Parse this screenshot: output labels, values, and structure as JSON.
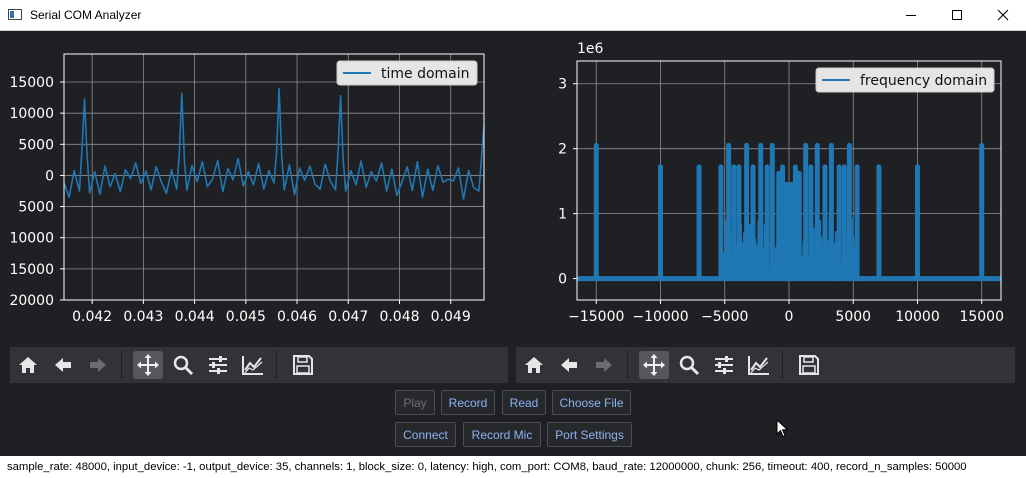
{
  "window": {
    "title": "Serial COM Analyzer",
    "controls": [
      "minimize-icon",
      "maximize-icon",
      "close-icon"
    ]
  },
  "plots": [
    {
      "chart_data": {
        "type": "line",
        "legend": "time domain",
        "legend_position": "top-right",
        "grid": true,
        "xlim": [
          0.04145,
          0.04965
        ],
        "ylim": [
          -20000,
          19500
        ],
        "x_ticks": [
          0.042,
          0.043,
          0.044,
          0.045,
          0.046,
          0.047,
          0.048,
          0.049
        ],
        "x_tick_labels": [
          "0.042",
          "0.043",
          "0.044",
          "0.045",
          "0.046",
          "0.047",
          "0.048",
          "0.049"
        ],
        "y_ticks": [
          15000,
          10000,
          5000,
          0,
          -5000,
          -10000,
          -15000,
          -20000
        ],
        "y_tick_labels": [
          "15000",
          "10000",
          "5000",
          "0",
          "5000",
          "10000",
          "15000",
          "20000"
        ],
        "series_color": "#1f77b4",
        "series": [
          {
            "name": "time domain",
            "x": [
              0.04145,
              0.04155,
              0.04165,
              0.04175,
              0.0418,
              0.04185,
              0.0419,
              0.04195,
              0.04205,
              0.04215,
              0.04225,
              0.04235,
              0.04245,
              0.04255,
              0.04265,
              0.04275,
              0.04285,
              0.04295,
              0.04305,
              0.04315,
              0.04325,
              0.04335,
              0.04345,
              0.04355,
              0.04365,
              0.0437,
              0.04375,
              0.0438,
              0.04385,
              0.04395,
              0.04405,
              0.04415,
              0.04425,
              0.04435,
              0.04445,
              0.04455,
              0.04465,
              0.04475,
              0.04485,
              0.04495,
              0.04505,
              0.04515,
              0.04525,
              0.04535,
              0.04545,
              0.04555,
              0.0456,
              0.04565,
              0.0457,
              0.04575,
              0.04585,
              0.04595,
              0.04605,
              0.04615,
              0.04625,
              0.04635,
              0.04645,
              0.04655,
              0.04665,
              0.04675,
              0.0468,
              0.04685,
              0.0469,
              0.04695,
              0.04705,
              0.04715,
              0.04725,
              0.04735,
              0.04745,
              0.04755,
              0.04765,
              0.04775,
              0.04785,
              0.04795,
              0.04805,
              0.04815,
              0.04825,
              0.04835,
              0.04845,
              0.04855,
              0.04865,
              0.04875,
              0.04885,
              0.04895,
              0.04905,
              0.04915,
              0.04925,
              0.04935,
              0.04945,
              0.04955,
              0.04965
            ],
            "values": [
              -1200,
              -3500,
              800,
              -2500,
              4000,
              12300,
              3500,
              -2800,
              600,
              -3000,
              1500,
              -1800,
              300,
              -2600,
              900,
              -500,
              2000,
              -1300,
              700,
              -2300,
              1400,
              -1000,
              -2900,
              900,
              -2200,
              3200,
              13200,
              2500,
              -2400,
              1600,
              -1000,
              2200,
              -1800,
              -600,
              2400,
              -2600,
              1100,
              -700,
              2700,
              -1700,
              600,
              -1500,
              1900,
              -2200,
              800,
              -1200,
              3800,
              14000,
              3100,
              -2300,
              1700,
              -3100,
              1200,
              -800,
              1500,
              -1400,
              -2200,
              1800,
              -900,
              -2300,
              3500,
              12800,
              2700,
              -2500,
              800,
              -1500,
              2300,
              -1900,
              600,
              -900,
              2000,
              -2500,
              1000,
              -3200,
              -1000,
              1400,
              -2400,
              2200,
              -3500,
              1000,
              -2400,
              1600,
              -1100,
              -600,
              -900,
              1200,
              -3800,
              800,
              -2000,
              -2500,
              8000
            ]
          }
        ]
      }
    },
    {
      "chart_data": {
        "type": "line",
        "legend": "frequency domain",
        "legend_position": "top-right",
        "grid": true,
        "scale_label": "1e6",
        "xlim": [
          -16500,
          16500
        ],
        "ylim": [
          -0.33,
          3.35
        ],
        "x_ticks": [
          -15000,
          -10000,
          -5000,
          0,
          5000,
          10000,
          15000
        ],
        "x_tick_labels": [
          "−15000",
          "−10000",
          "−5000",
          "0",
          "5000",
          "10000",
          "15000"
        ],
        "y_ticks": [
          0,
          1,
          2,
          3
        ],
        "y_tick_labels": [
          "0",
          "1",
          "2",
          "3"
        ],
        "series_color": "#1f77b4",
        "series": [
          {
            "name": "frequency domain",
            "spikes": [
              {
                "x": -15000,
                "value": 2.05
              },
              {
                "x": -10000,
                "value": 1.72
              },
              {
                "x": -7000,
                "value": 1.72
              },
              {
                "x": -5300,
                "value": 1.72
              },
              {
                "x": -4700,
                "value": 2.05
              },
              {
                "x": -4300,
                "value": 1.72
              },
              {
                "x": -3900,
                "value": 1.72
              },
              {
                "x": -3300,
                "value": 2.05
              },
              {
                "x": -2800,
                "value": 1.72
              },
              {
                "x": -2200,
                "value": 2.05
              },
              {
                "x": -1700,
                "value": 1.72
              },
              {
                "x": -1300,
                "value": 2.05
              },
              {
                "x": -800,
                "value": 1.62
              },
              {
                "x": -500,
                "value": 1.72
              },
              {
                "x": -200,
                "value": 1.45
              },
              {
                "x": 200,
                "value": 1.45
              },
              {
                "x": 500,
                "value": 1.72
              },
              {
                "x": 800,
                "value": 1.62
              },
              {
                "x": 1300,
                "value": 2.05
              },
              {
                "x": 1700,
                "value": 1.72
              },
              {
                "x": 2200,
                "value": 2.05
              },
              {
                "x": 2800,
                "value": 1.72
              },
              {
                "x": 3300,
                "value": 2.05
              },
              {
                "x": 3900,
                "value": 1.72
              },
              {
                "x": 4300,
                "value": 1.72
              },
              {
                "x": 4700,
                "value": 2.05
              },
              {
                "x": 5300,
                "value": 1.72
              },
              {
                "x": 7000,
                "value": 1.72
              },
              {
                "x": 10000,
                "value": 1.72
              },
              {
                "x": 15000,
                "value": 2.05
              }
            ],
            "noise_band": [
              -5300,
              5300
            ]
          }
        ]
      }
    }
  ],
  "toolbars": [
    {
      "icons": [
        "home-icon",
        "back-arrow-icon",
        "forward-arrow-icon",
        "pan-icon",
        "zoom-icon",
        "configure-subplots-icon",
        "edit-axis-icon",
        "save-icon"
      ],
      "active": "pan-icon"
    },
    {
      "icons": [
        "home-icon",
        "back-arrow-icon",
        "forward-arrow-icon",
        "pan-icon",
        "zoom-icon",
        "configure-subplots-icon",
        "edit-axis-icon",
        "save-icon"
      ],
      "active": "pan-icon"
    }
  ],
  "buttons": {
    "play": "Play",
    "record": "Record",
    "read": "Read",
    "choose_file": "Choose File",
    "connect": "Connect",
    "record_mic": "Record Mic",
    "port_settings": "Port Settings"
  },
  "status": "sample_rate: 48000, input_device: -1, output_device: 35, channels: 1, block_size: 0, latency: high, com_port: COM8, baud_rate: 12000000, chunk: 256, timeout: 400, record_n_samples: 50000",
  "colors": {
    "window_bg": "#1f2023",
    "axes_bg": "#1f2023",
    "series": "#1f77b4",
    "grid": "#b0b0b0",
    "button_text": "#8ab4f0",
    "disabled_text": "#6b6e74",
    "toolbar_bg": "#323338"
  }
}
